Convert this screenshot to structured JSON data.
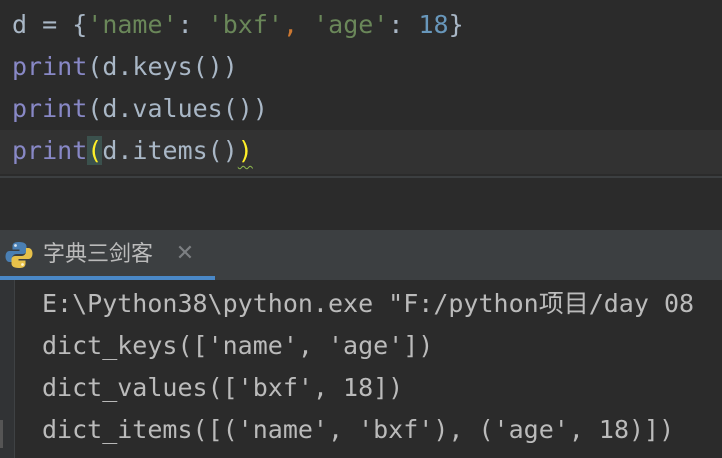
{
  "editor": {
    "lines": [
      {
        "var": "d",
        "op": " = {",
        "key1": "'name'",
        "colon1": ": ",
        "val1": "'bxf'",
        "comma": ",",
        "space": " ",
        "key2": "'age'",
        "colon2": ": ",
        "val2": "18",
        "close": "}"
      },
      {
        "func": "print",
        "args": "(d.keys())"
      },
      {
        "func": "print",
        "args": "(d.values())"
      },
      {
        "func": "print",
        "open_paren": "(",
        "inner": "d.items()",
        "close_paren": ")"
      }
    ]
  },
  "run_window": {
    "tab_title": "字典三剑客",
    "close_label": "✕",
    "icon": "python-icon"
  },
  "console": {
    "lines": [
      "E:\\Python38\\python.exe \"F:/python项目/day 08",
      "dict_keys(['name', 'age'])",
      "dict_values(['bxf', 18])",
      "dict_items([('name', 'bxf'), ('age', 18)])"
    ]
  },
  "colors": {
    "editor_bg": "#2b2b2b",
    "keyword_builtin": "#8888c6",
    "string": "#6a8759",
    "number": "#6897bb",
    "comma": "#cc7832",
    "tab_underline": "#4a88c7",
    "paren_match": "#ffef28"
  }
}
